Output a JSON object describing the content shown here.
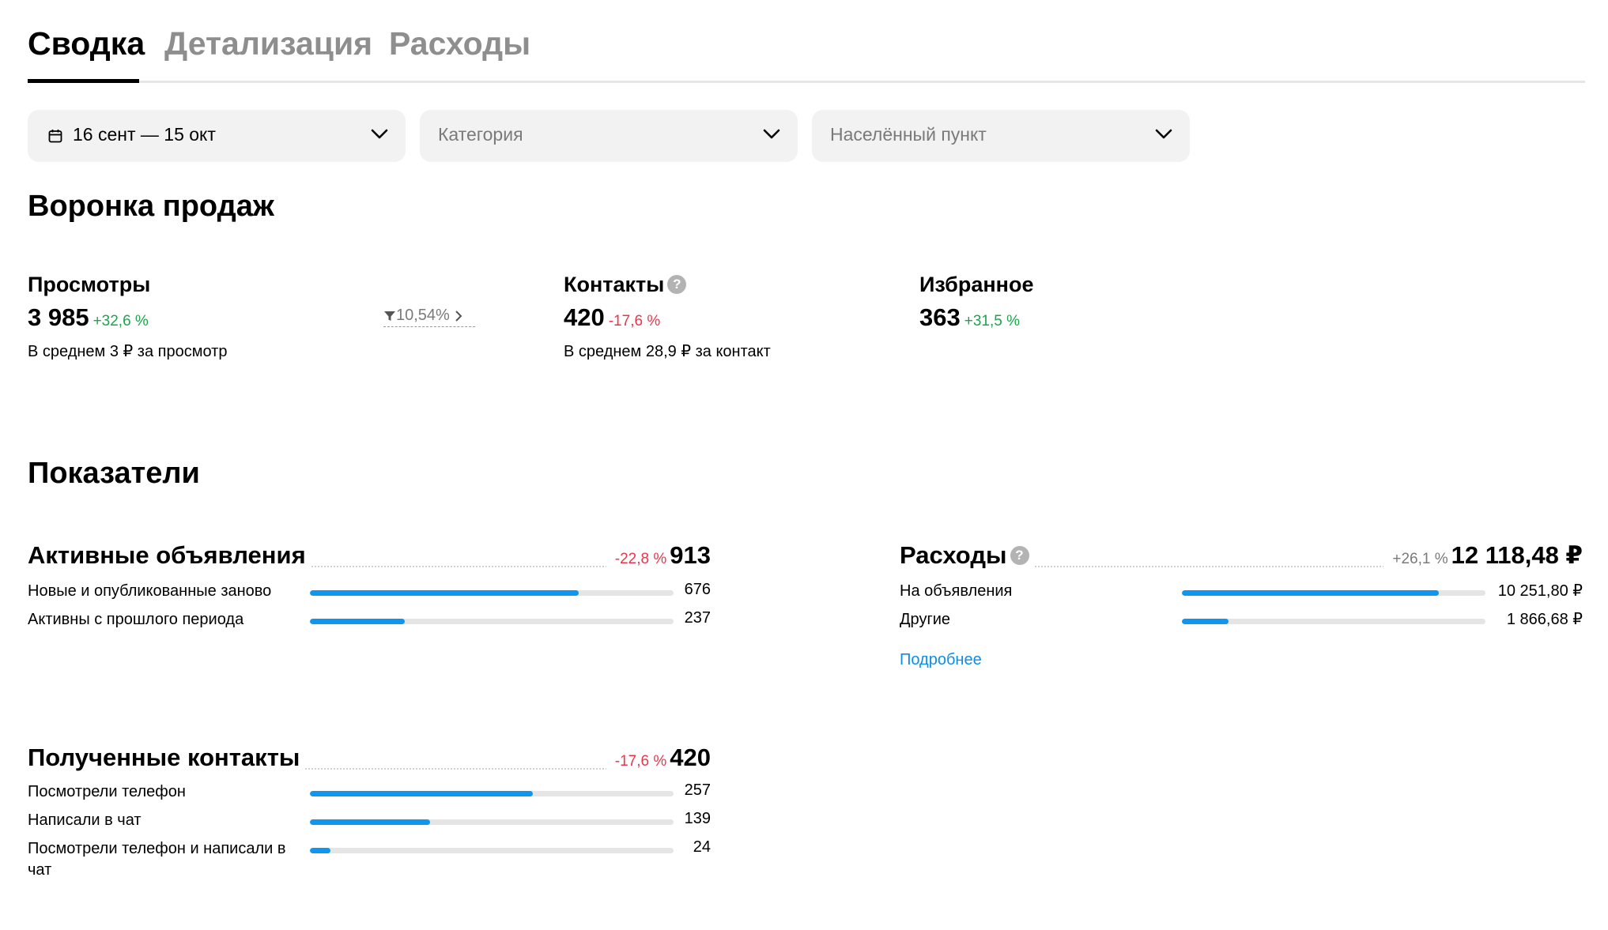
{
  "tabs": [
    {
      "label": "Сводка",
      "active": true
    },
    {
      "label": "Детализация",
      "active": false
    },
    {
      "label": "Расходы",
      "active": false
    }
  ],
  "filters": {
    "period": "16 сент — 15 окт",
    "category_placeholder": "Категория",
    "location_placeholder": "Населённый пункт"
  },
  "funnel": {
    "title": "Воронка продаж",
    "views": {
      "label": "Просмотры",
      "value": "3 985",
      "change": "+32,6 %",
      "sub": "В среднем 3 ₽ за просмотр"
    },
    "conversion": "10,54%",
    "contacts": {
      "label": "Контакты",
      "value": "420",
      "change": "-17,6 %",
      "sub": "В среднем 28,9 ₽ за контакт"
    },
    "favorites": {
      "label": "Избранное",
      "value": "363",
      "change": "+31,5 %"
    }
  },
  "indicators": {
    "title": "Показатели",
    "active_ads": {
      "title": "Активные объявления",
      "change": "-22,8 %",
      "total": "913",
      "rows": [
        {
          "label": "Новые и опубликованные заново",
          "value": "676",
          "fraction": 0.74
        },
        {
          "label": "Активны с прошлого периода",
          "value": "237",
          "fraction": 0.26
        }
      ]
    },
    "expenses": {
      "title": "Расходы",
      "change": "+26,1 %",
      "total": "12 118,48 ₽",
      "rows": [
        {
          "label": "На объявления",
          "value": "10 251,80 ₽",
          "fraction": 0.846
        },
        {
          "label": "Другие",
          "value": "1 866,68 ₽",
          "fraction": 0.154
        }
      ],
      "more_link": "Подробнее"
    },
    "contacts": {
      "title": "Полученные контакты",
      "change": "-17,6 %",
      "total": "420",
      "rows": [
        {
          "label": "Посмотрели телефон",
          "value": "257",
          "fraction": 0.612
        },
        {
          "label": "Написали в чат",
          "value": "139",
          "fraction": 0.331
        },
        {
          "label": "Посмотрели телефон и написали в чат",
          "value": "24",
          "fraction": 0.057
        }
      ]
    }
  },
  "colors": {
    "accent": "#0f97ef",
    "positive": "#1aa64a",
    "negative": "#e8374b",
    "link": "#0a8ee8"
  },
  "icons": {
    "period": "calendar-icon",
    "dropdown": "chevron-down-icon",
    "help": "question-icon",
    "conversion": "funnel-icon"
  }
}
